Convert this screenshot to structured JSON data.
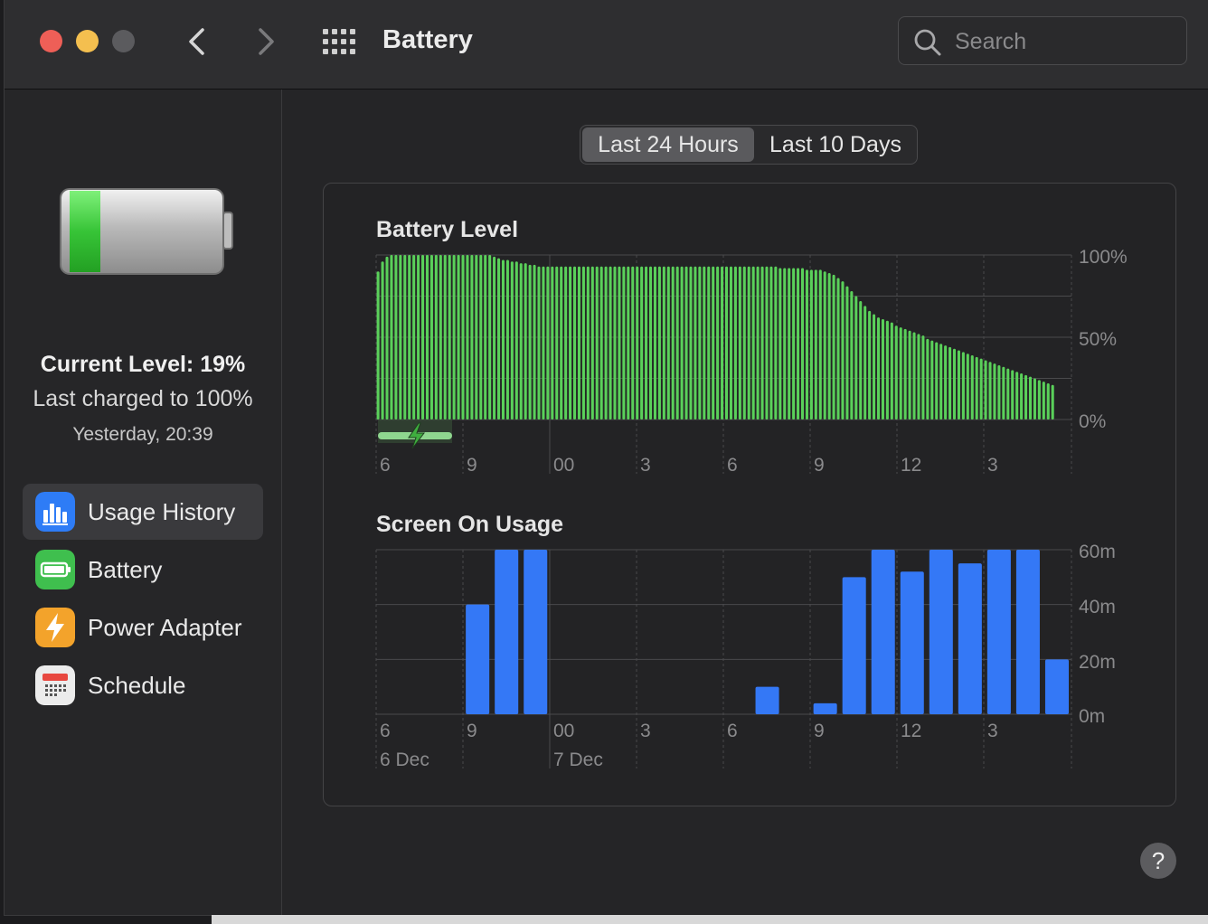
{
  "window": {
    "title": "Battery"
  },
  "search": {
    "placeholder": "Search"
  },
  "icons": {
    "close": "close-dot",
    "minimize": "minimize-dot",
    "zoom": "zoom-dot",
    "back": "chevron-left-icon",
    "forward": "chevron-right-icon",
    "grid": "grid-icon",
    "search": "magnifier-icon",
    "help": "question-mark-icon"
  },
  "colors": {
    "battery_bar": "#5ad05a",
    "charging": "#8fd68f",
    "usage_bar": "#3478f6",
    "grid_line": "#4a4a4c"
  },
  "sidebar": {
    "current_level": "Current Level: 19%",
    "last_charged": "Last charged to 100%",
    "charged_time": "Yesterday, 20:39",
    "items": [
      {
        "label": "Usage History",
        "icon": "bar-chart-icon",
        "color": "#2e7cf6",
        "active": true
      },
      {
        "label": "Battery",
        "icon": "battery-icon",
        "color": "#3fbf4e",
        "active": false
      },
      {
        "label": "Power Adapter",
        "icon": "lightning-icon",
        "color": "#f3a32b",
        "active": false
      },
      {
        "label": "Schedule",
        "icon": "calendar-icon",
        "color": "#e8e8e8",
        "active": false
      }
    ]
  },
  "tabs": [
    {
      "label": "Last 24 Hours",
      "selected": true
    },
    {
      "label": "Last 10 Days",
      "selected": false
    }
  ],
  "help": {
    "label": "?"
  },
  "chart_data": [
    {
      "type": "bar",
      "title": "Battery Level",
      "yticks": [
        "100%",
        "50%",
        "0%"
      ],
      "ylim": [
        0,
        100
      ],
      "x_ticks": [
        "6",
        "9",
        "00",
        "3",
        "6",
        "9",
        "12",
        "3"
      ],
      "grid": true,
      "charging_marker": "lightning-icon",
      "values": [
        90,
        96,
        99,
        100,
        100,
        100,
        100,
        100,
        100,
        100,
        100,
        100,
        100,
        100,
        100,
        100,
        100,
        100,
        100,
        100,
        100,
        100,
        100,
        100,
        100,
        100,
        99,
        98,
        97,
        97,
        96,
        96,
        95,
        95,
        94,
        94,
        93,
        93,
        93,
        93,
        93,
        93,
        93,
        93,
        93,
        93,
        93,
        93,
        93,
        93,
        93,
        93,
        93,
        93,
        93,
        93,
        93,
        93,
        93,
        93,
        93,
        93,
        93,
        93,
        93,
        93,
        93,
        93,
        93,
        93,
        93,
        93,
        93,
        93,
        93,
        93,
        93,
        93,
        93,
        93,
        93,
        93,
        93,
        93,
        93,
        93,
        93,
        93,
        93,
        93,
        92,
        92,
        92,
        92,
        92,
        92,
        91,
        91,
        91,
        91,
        90,
        89,
        88,
        86,
        84,
        81,
        78,
        75,
        72,
        69,
        66,
        64,
        62,
        61,
        60,
        59,
        57,
        56,
        55,
        54,
        53,
        52,
        51,
        49,
        48,
        47,
        46,
        45,
        44,
        43,
        42,
        41,
        40,
        39,
        38,
        37,
        36,
        35,
        34,
        33,
        32,
        31,
        30,
        29,
        28,
        27,
        26,
        25,
        24,
        23,
        22,
        21
      ]
    },
    {
      "type": "bar",
      "title": "Screen On Usage",
      "yticks": [
        "60m",
        "40m",
        "20m",
        "0m"
      ],
      "ylim": [
        0,
        60
      ],
      "x_ticks": [
        "6",
        "9",
        "00",
        "3",
        "6",
        "9",
        "12",
        "3"
      ],
      "date_labels": [
        "6 Dec",
        "7 Dec"
      ],
      "grid": true,
      "values": [
        0,
        0,
        0,
        40,
        60,
        60,
        0,
        0,
        0,
        0,
        0,
        0,
        0,
        10,
        0,
        4,
        50,
        60,
        52,
        60,
        55,
        60,
        60,
        20
      ]
    }
  ]
}
